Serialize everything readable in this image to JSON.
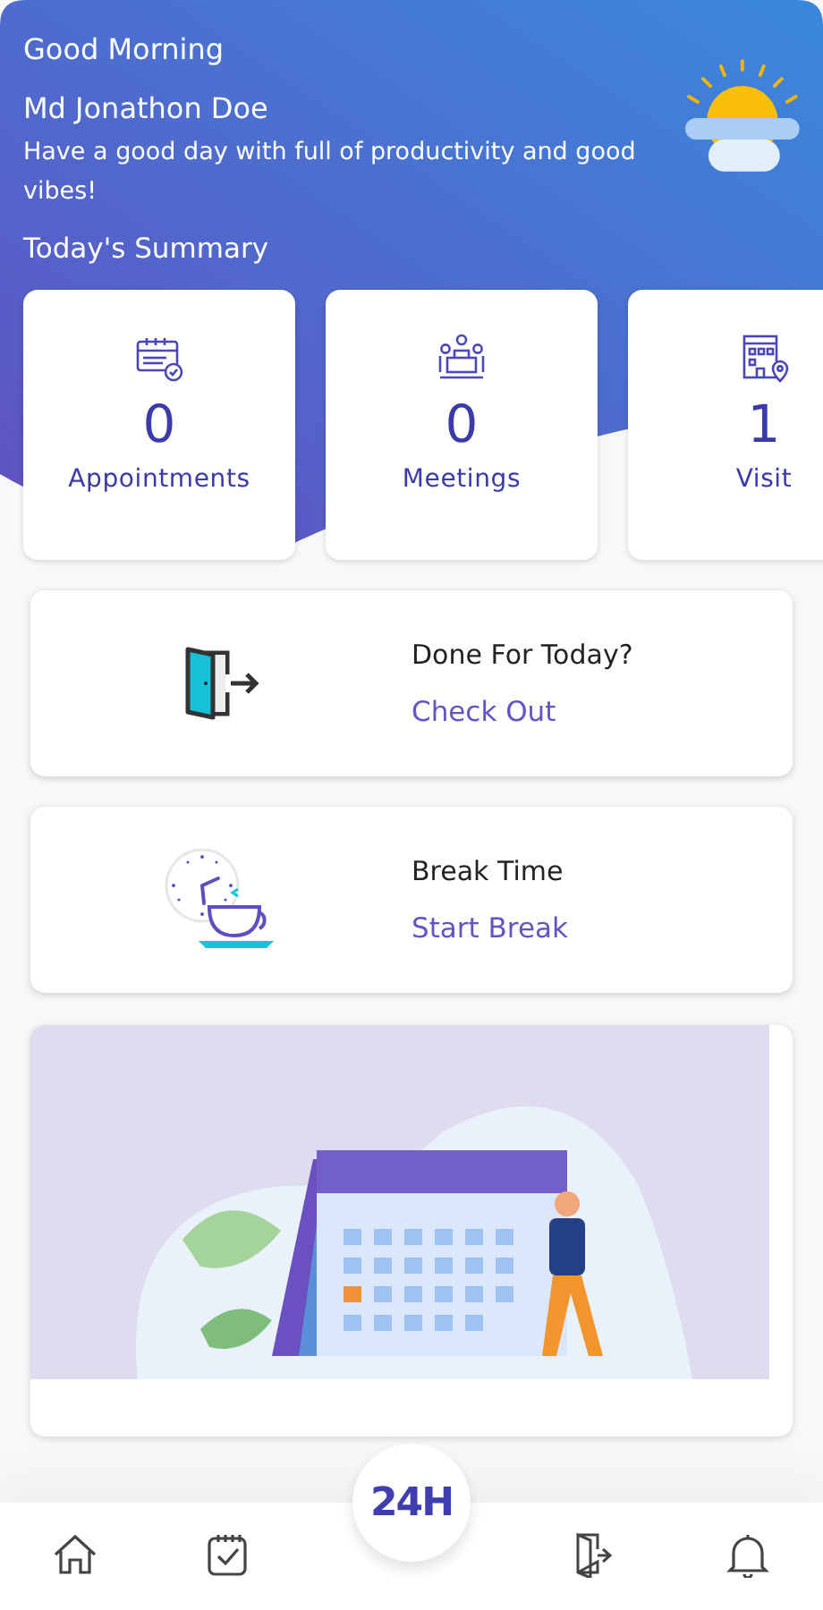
{
  "header": {
    "greeting": "Good Morning",
    "name": "Md Jonathon Doe",
    "message": "Have a good day with full of productivity and good vibes!"
  },
  "summary": {
    "title": "Today's Summary",
    "cards": [
      {
        "kind": "appointments",
        "count": "0",
        "label": "Appointments"
      },
      {
        "kind": "meetings",
        "count": "0",
        "label": "Meetings"
      },
      {
        "kind": "visit",
        "count": "1",
        "label": "Visit"
      }
    ]
  },
  "actions": [
    {
      "kind": "checkout",
      "title": "Done For Today?",
      "link": "Check Out"
    },
    {
      "kind": "break",
      "title": "Break Time",
      "link": "Start Break"
    }
  ],
  "bottom_nav": {
    "center": "24H",
    "items": [
      {
        "kind": "home"
      },
      {
        "kind": "tasks"
      },
      {
        "kind": "checkout"
      },
      {
        "kind": "notifications"
      }
    ]
  }
}
